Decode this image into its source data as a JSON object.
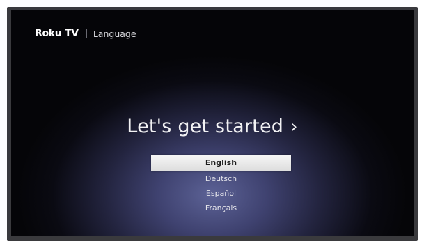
{
  "header": {
    "brand": "Roku TV",
    "section": "Language"
  },
  "main": {
    "headline": "Let's get started",
    "chevron": "›",
    "languages": [
      {
        "label": "English",
        "selected": true
      },
      {
        "label": "Deutsch",
        "selected": false
      },
      {
        "label": "Español",
        "selected": false
      },
      {
        "label": "Français",
        "selected": false
      }
    ]
  },
  "colors": {
    "background_glow": "#5c6296",
    "selected_item": "#e8e8e8"
  }
}
